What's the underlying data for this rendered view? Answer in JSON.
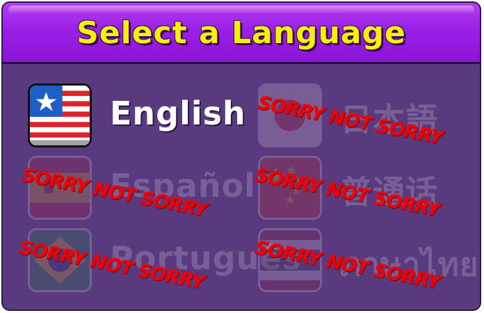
{
  "header": {
    "title": "Select a Language"
  },
  "languages": [
    {
      "label": "English",
      "flag": "us-flag",
      "locked": false
    },
    {
      "label": "日本語",
      "flag": "japan-flag",
      "locked": true,
      "stamp": "SORRY NOT SORRY"
    },
    {
      "label": "Español",
      "flag": "spain-flag",
      "locked": true,
      "stamp": "SORRY NOT SORRY"
    },
    {
      "label": "普通话",
      "flag": "china-flag",
      "locked": true,
      "stamp": "SORRY NOT SORRY"
    },
    {
      "label": "Português",
      "flag": "brazil-flag",
      "locked": true,
      "stamp": "SORRY NOT SORRY"
    },
    {
      "label": "ภาษาไทย",
      "flag": "thailand-flag",
      "locked": true,
      "stamp": "SORRY NOT SORRY"
    }
  ],
  "colors": {
    "panel": "#5a3a7e",
    "header": "#9a20e6",
    "title": "#f4f200",
    "stamp": "#f20000"
  }
}
